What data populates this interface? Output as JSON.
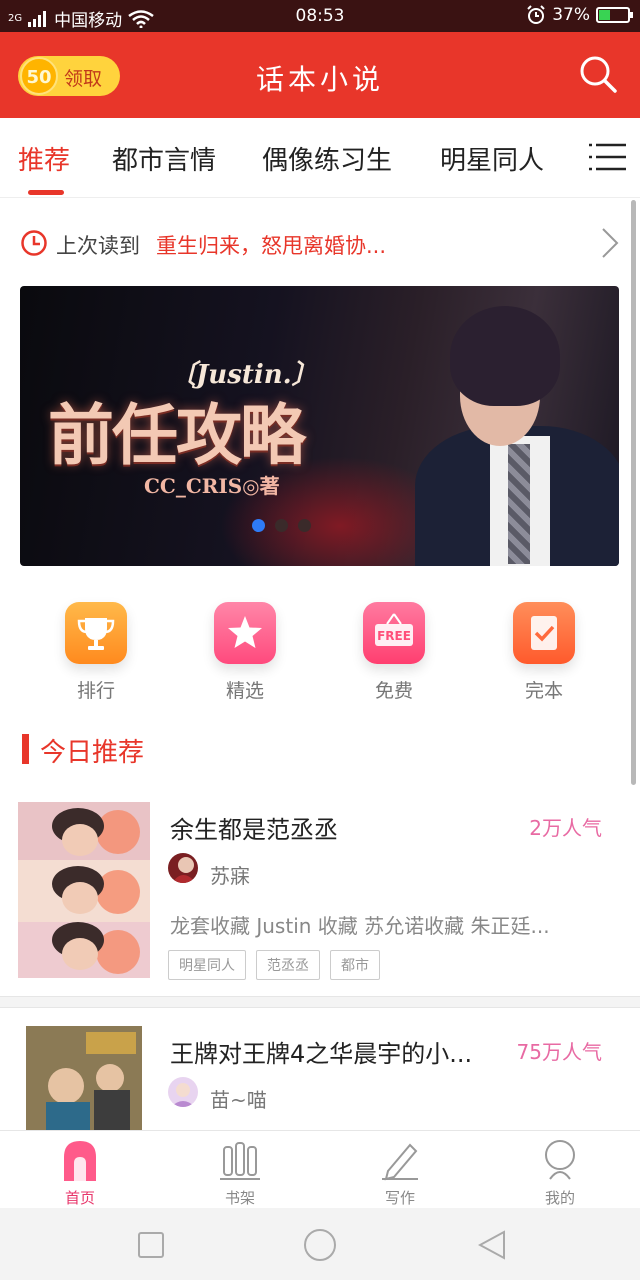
{
  "status": {
    "carrier": "中国移动",
    "signal": "2G",
    "time": "08:53",
    "battery": "37%",
    "battery_level": 0.37
  },
  "appbar": {
    "claim_coins": "50",
    "claim_label": "领取",
    "title": "话本小说"
  },
  "tabs": [
    {
      "label": "推荐",
      "active": true
    },
    {
      "label": "都市言情"
    },
    {
      "label": "偶像练习生"
    },
    {
      "label": "明星同人"
    }
  ],
  "last_read": {
    "prefix": "上次读到",
    "book": "重生归来，怒甩离婚协..."
  },
  "banner": {
    "author_tag": "〔Justin.〕",
    "title": "前任攻略",
    "byline": "CC_CRIS◎著",
    "page_count": 3,
    "active_page": 0
  },
  "quick_links": [
    {
      "label": "排行",
      "icon": "trophy-icon",
      "color": "#ff9a2e"
    },
    {
      "label": "精选",
      "icon": "star-icon",
      "color": "#ff5c8a"
    },
    {
      "label": "免费",
      "icon": "free-sign-icon",
      "color": "#ff4f7a"
    },
    {
      "label": "完本",
      "icon": "check-note-icon",
      "color": "#ff6a3d"
    }
  ],
  "section": {
    "title": "今日推荐"
  },
  "books": [
    {
      "title": "余生都是范丞丞",
      "popularity": "2万人气",
      "author": "苏寐",
      "description": "龙套收藏 Justin 收藏 苏允诺收藏 朱正廷...",
      "tags": [
        "明星同人",
        "范丞丞",
        "都市"
      ]
    },
    {
      "title": "王牌对王牌4之华晨宇的小...",
      "popularity": "75万人气",
      "author": "苗~喵",
      "description": "",
      "tags": []
    }
  ],
  "bottom_nav": [
    {
      "label": "首页",
      "icon": "home-icon",
      "active": true
    },
    {
      "label": "书架",
      "icon": "bookshelf-icon"
    },
    {
      "label": "写作",
      "icon": "pen-icon"
    },
    {
      "label": "我的",
      "icon": "profile-icon"
    }
  ],
  "colors": {
    "brand": "#e8362a",
    "accent_pink": "#e8366b",
    "popularity": "#e86aa3"
  }
}
